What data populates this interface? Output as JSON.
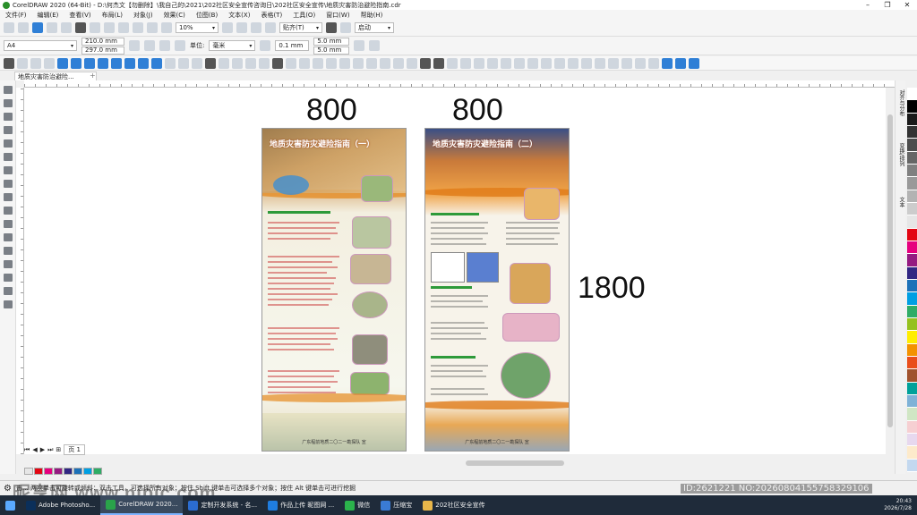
{
  "window": {
    "title": "CorelDRAW 2020 (64-Bit) - D:\\何杰文【勿删除】\\我自己的\\2021\\202社区安全宣传咨询日\\202社区安全宣传\\地质灾害防治避险指南.cdr"
  },
  "menu": [
    "文件(F)",
    "编辑(E)",
    "查看(V)",
    "布局(L)",
    "对象(J)",
    "效果(C)",
    "位图(B)",
    "文本(X)",
    "表格(T)",
    "工具(O)",
    "窗口(W)",
    "帮助(H)"
  ],
  "toolbar": {
    "zoom": "10%",
    "snap_label": "贴齐(T)",
    "launch_label": "启动"
  },
  "property_bar": {
    "page_size": "A4",
    "width": "210.0 mm",
    "height": "297.0 mm",
    "unit_label": "单位:",
    "unit": "毫米",
    "nudge": "0.1 mm",
    "dup_x": "5.0 mm",
    "dup_y": "5.0 mm"
  },
  "doc_tab": "地质灾害防治避险...",
  "rulers": {
    "h_ticks": [
      "1400",
      "1200",
      "1000",
      "800",
      "600",
      "400",
      "200",
      "0",
      "200",
      "400",
      "600",
      "800",
      "1000",
      "1200",
      "1400",
      "1600",
      "1800",
      "2000",
      "2200"
    ]
  },
  "canvas": {
    "width_label_1": "800",
    "width_label_2": "800",
    "height_label": "1800",
    "poster1": {
      "title": "地质灾害防灾避险指南（一）",
      "footer": "广东程前地质二〇二一勘探队   宣"
    },
    "poster2": {
      "title": "地质灾害防灾避险指南（二）",
      "footer": "广东程前地质二〇二一勘探队   宣"
    }
  },
  "pager": {
    "page_label": "页 1"
  },
  "right_dock": {
    "tabs": [
      "对齐与分布",
      "变换/排列",
      "文本"
    ]
  },
  "status_bar": {
    "text": "击... 两次单击可旋转或倾斜；双击工具，可选择所有对象；按住 Shift 键单击可选择多个对象；按住 Alt 键单击可进行挖掘"
  },
  "watermarks": {
    "left": "昵享网 www.nipic.com",
    "right": "ID:2621221 NO:20260804155758329106"
  },
  "taskbar": {
    "items": [
      {
        "label": "Adobe Photosho...",
        "color": "#0b2f5a"
      },
      {
        "label": "CorelDRAW 2020...",
        "color": "#2aa34a"
      },
      {
        "label": "定制开发系统 - 名...",
        "color": "#2b6cd0"
      },
      {
        "label": "作品上传 昵图网 ...",
        "color": "#1f7de0"
      },
      {
        "label": "微信",
        "color": "#2bb24c"
      },
      {
        "label": "压缩宝",
        "color": "#3a7bd5"
      },
      {
        "label": "202社区安全宣传",
        "color": "#e8b64a"
      }
    ],
    "time": "20:43",
    "date": "2026/7/28"
  },
  "colors": {
    "palette": [
      "#ffffff",
      "#000000",
      "#1a1a1a",
      "#333333",
      "#4d4d4d",
      "#666666",
      "#808080",
      "#999999",
      "#b3b3b3",
      "#cccccc",
      "#e6e6e6",
      "#e30613",
      "#e6007e",
      "#951b81",
      "#312783",
      "#1d71b8",
      "#009fe3",
      "#2fac66",
      "#95c11f",
      "#ffed00",
      "#f39200",
      "#e94e1b",
      "#a0522d",
      "#00a19a",
      "#7fb2d7",
      "#d0e6c4",
      "#f6cfd2",
      "#e7d8ee",
      "#fdeacb",
      "#c3d8ef"
    ]
  }
}
